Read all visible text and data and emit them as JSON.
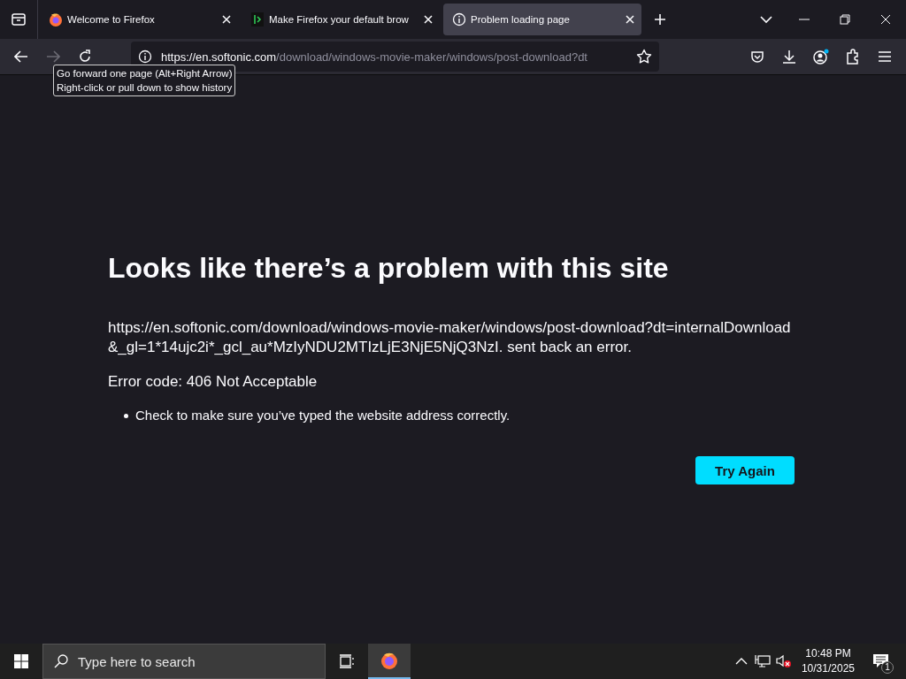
{
  "tabs": [
    {
      "title": "Welcome to Firefox",
      "selected": false
    },
    {
      "title": "Make Firefox your default brow",
      "selected": false
    },
    {
      "title": "Problem loading page",
      "selected": true
    }
  ],
  "nav": {
    "url_host": "https://en.softonic.com",
    "url_path": "/download/windows-movie-maker/windows/post-download?dt",
    "tooltip": [
      "Go forward one page (Alt+Right Arrow)",
      "Right-click or pull down to show history"
    ]
  },
  "error": {
    "title": "Looks like there’s a problem with this site",
    "message": "https://en.softonic.com/download/windows-movie-maker/windows/post-download?dt=internalDownload&_gl=1*14ujc2i*_gcl_au*MzIyNDU2MTIzLjE3NjE5NjQ3NzI. sent back an error.",
    "code": "Error code: 406 Not Acceptable",
    "tips": [
      "Check to make sure you’ve typed the website address correctly."
    ],
    "button": "Try Again"
  },
  "taskbar": {
    "search_placeholder": "Type here to search",
    "time": "10:48 PM",
    "date": "10/31/2025",
    "notification_count": "1"
  }
}
